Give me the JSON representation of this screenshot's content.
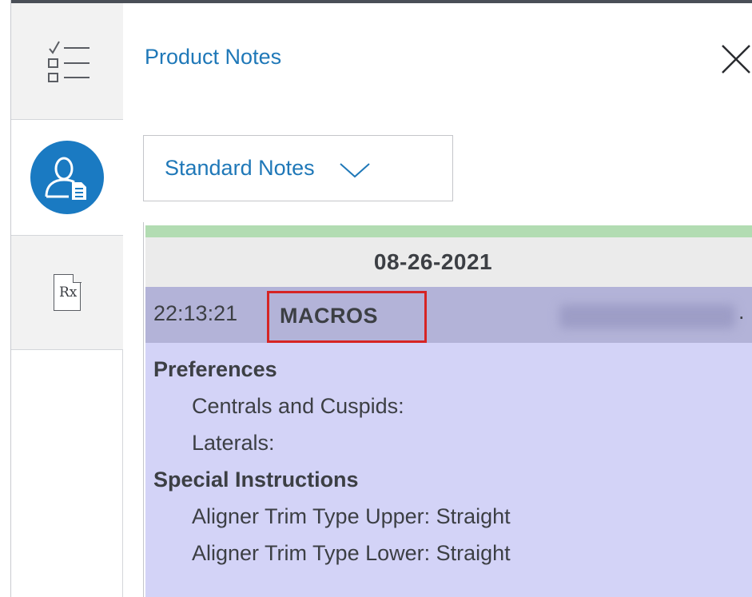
{
  "panel": {
    "title": "Product Notes"
  },
  "dropdown": {
    "selected": "Standard Notes"
  },
  "rail": {
    "tabs": [
      {
        "name": "checklist",
        "icon": "checklist-icon"
      },
      {
        "name": "patient-document",
        "icon": "patient-document-icon",
        "active_color": "#1a7ac2"
      },
      {
        "name": "prescription",
        "icon": "rx-icon",
        "label": "Rx"
      }
    ]
  },
  "notes": {
    "date": "08-26-2021",
    "entry": {
      "time": "22:13:21",
      "type": "MACROS",
      "trailing": "."
    },
    "body": {
      "preferences_heading": "Preferences",
      "centrals_label": "Centrals and Cuspids:",
      "laterals_label": "Laterals:",
      "special_heading": "Special Instructions",
      "trim_upper": "Aligner Trim Type Upper: Straight",
      "trim_lower": "Aligner Trim Type Lower: Straight"
    }
  },
  "colors": {
    "title_blue": "#1f78b8",
    "highlight_red": "#d62424",
    "note_header": "#b3b3d8",
    "note_body": "#d3d3f7",
    "green_bar": "#b2dcb2"
  }
}
